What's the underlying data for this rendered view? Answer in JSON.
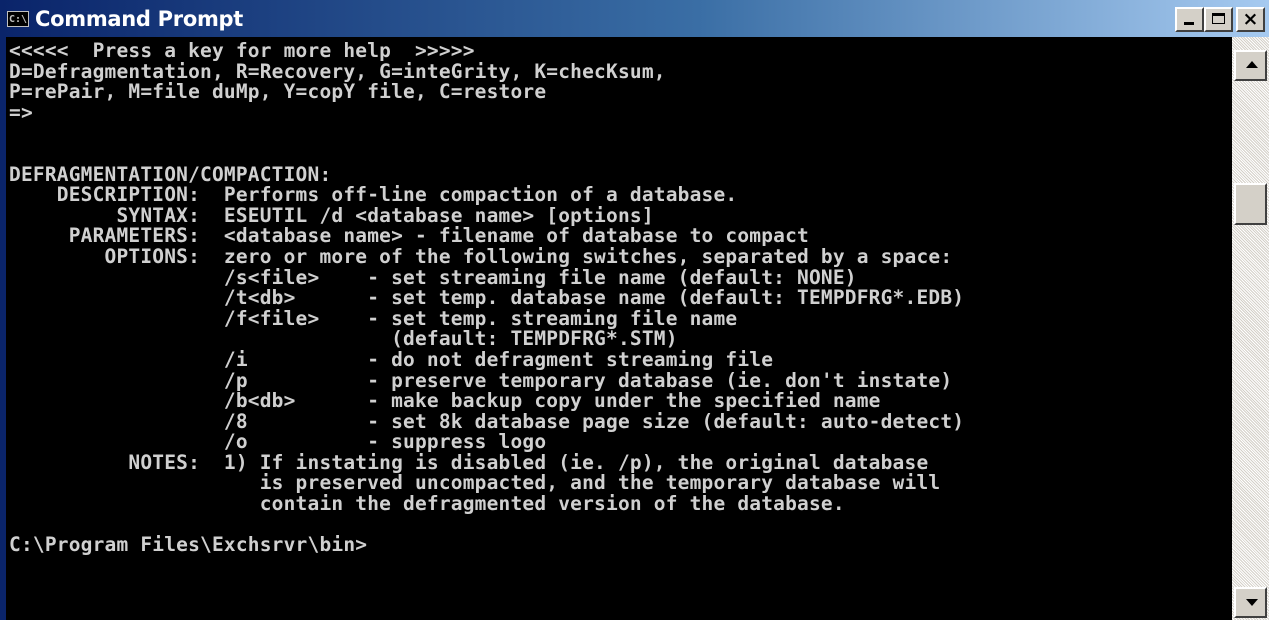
{
  "window": {
    "title": "Command Prompt",
    "icon_text": "C:\\",
    "icon_name": "console-app-icon"
  },
  "controls": {
    "minimize": "minimize-icon",
    "maximize": "maximize-icon",
    "close": "×"
  },
  "console": {
    "lines": [
      "<<<<<  Press a key for more help  >>>>>",
      "D=Defragmentation, R=Recovery, G=inteGrity, K=checKsum,",
      "P=rePair, M=file duMp, Y=copY file, C=restore",
      "=>",
      "",
      "",
      "DEFRAGMENTATION/COMPACTION:",
      "    DESCRIPTION:  Performs off-line compaction of a database.",
      "         SYNTAX:  ESEUTIL /d <database name> [options]",
      "     PARAMETERS:  <database name> - filename of database to compact",
      "        OPTIONS:  zero or more of the following switches, separated by a space:",
      "                  /s<file>    - set streaming file name (default: NONE)",
      "                  /t<db>      - set temp. database name (default: TEMPDFRG*.EDB)",
      "                  /f<file>    - set temp. streaming file name",
      "                                (default: TEMPDFRG*.STM)",
      "                  /i          - do not defragment streaming file",
      "                  /p          - preserve temporary database (ie. don't instate)",
      "                  /b<db>      - make backup copy under the specified name",
      "                  /8          - set 8k database page size (default: auto-detect)",
      "                  /o          - suppress logo",
      "          NOTES:  1) If instating is disabled (ie. /p), the original database",
      "                     is preserved uncompacted, and the temporary database will",
      "                     contain the defragmented version of the database.",
      "",
      "C:\\Program Files\\Exchsrvr\\bin>"
    ]
  },
  "scrollbar": {
    "up_icon": "scroll-up-arrow-icon",
    "down_icon": "scroll-down-arrow-icon"
  },
  "colors": {
    "console_background": "#000000",
    "console_text": "#c0c0c0",
    "titlebar_start": "#0a246a",
    "titlebar_end": "#a6caf0"
  }
}
